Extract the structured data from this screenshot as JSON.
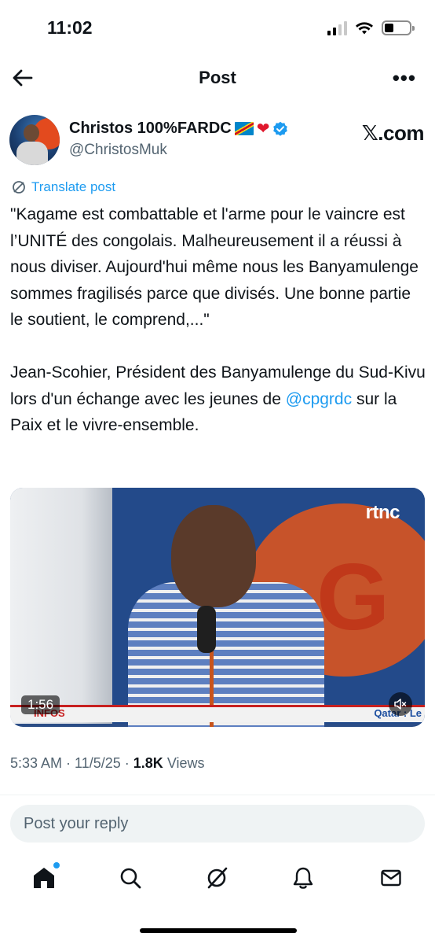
{
  "status_bar": {
    "time": "11:02"
  },
  "nav": {
    "title": "Post"
  },
  "author": {
    "name": "Christos 100%FARDC",
    "handle": "@ChristosMuk",
    "source": "𝕏.com"
  },
  "translate_label": "Translate post",
  "post": {
    "paragraph1": "\"Kagame est combattable et l'arme pour le vaincre est l’UNITÉ des congolais. Malheureusement il a réussi à nous diviser. Aujourd'hui même nous les Banyamulenge sommes fragilisés parce que divisés. Une bonne partie le soutient, le comprend,...\"",
    "paragraph2_before": "Jean-Scohier, Président des Banyamulenge du Sud-Kivu lors d'un échange avec les jeunes de ",
    "mention": "@cpgrdc",
    "paragraph2_after": " sur la Paix et le vivre-ensemble."
  },
  "video": {
    "duration": "1:56",
    "channel": "rtnc",
    "ticker_left": "INFOS",
    "ticker_right": "Qatar : Le"
  },
  "meta": {
    "time": "5:33 AM",
    "date": "11/5/25",
    "views_count": "1.8K",
    "views_label": "Views"
  },
  "reply": {
    "placeholder": "Post your reply"
  },
  "colors": {
    "accent": "#1d9bf0",
    "text": "#0f1419",
    "secondary": "#536471"
  }
}
